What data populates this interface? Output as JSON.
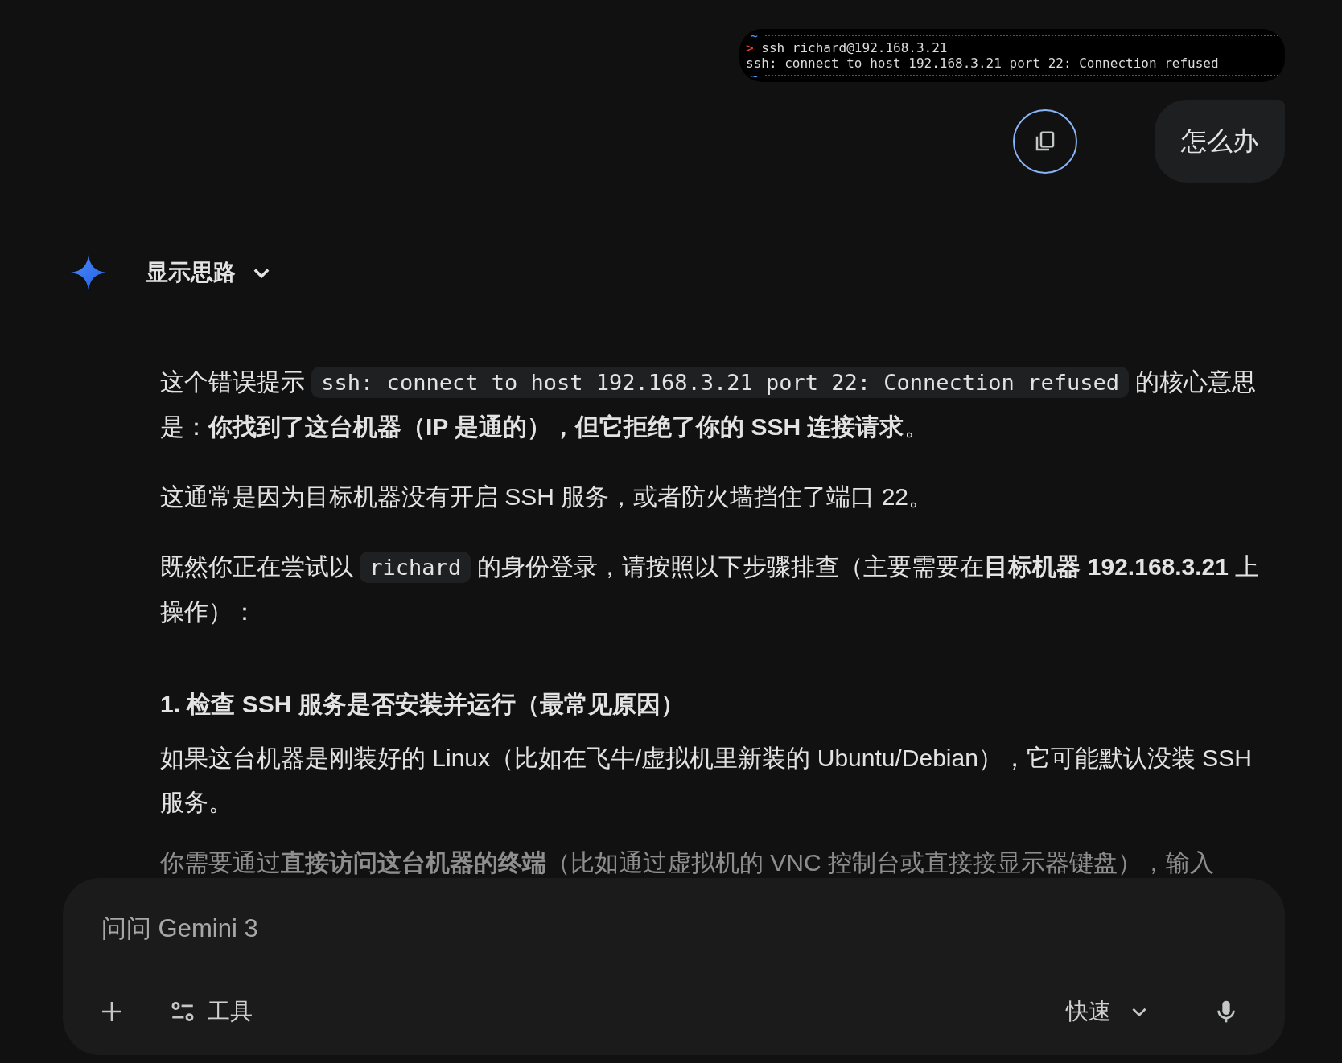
{
  "user_message": {
    "attachment": {
      "kind": "terminal",
      "lines": [
        {
          "kind": "tilde",
          "text": "~"
        },
        {
          "kind": "command",
          "prompt": ">",
          "text": "ssh richard@192.168.3.21"
        },
        {
          "kind": "output",
          "text": "ssh: connect to host 192.168.3.21 port 22: Connection refused"
        },
        {
          "kind": "tilde",
          "text": "~"
        }
      ]
    },
    "text": "怎么办"
  },
  "response": {
    "thoughts_toggle": {
      "label": "显示思路",
      "expanded": false
    },
    "blocks": [
      {
        "kind": "paragraph",
        "segments": [
          {
            "kind": "text",
            "text": "这个错误提示 "
          },
          {
            "kind": "code",
            "text": "ssh: connect to host 192.168.3.21 port 22: Connection refused"
          },
          {
            "kind": "text",
            "text": " 的核心意思是："
          },
          {
            "kind": "bold",
            "text": "你找到了这台机器（IP 是通的），但它拒绝了你的 SSH 连接请求"
          },
          {
            "kind": "text",
            "text": "。"
          }
        ]
      },
      {
        "kind": "paragraph",
        "segments": [
          {
            "kind": "text",
            "text": "这通常是因为目标机器没有开启 SSH 服务，或者防火墙挡住了端口 22。"
          }
        ]
      },
      {
        "kind": "paragraph",
        "segments": [
          {
            "kind": "text",
            "text": "既然你正在尝试以 "
          },
          {
            "kind": "code",
            "text": "richard"
          },
          {
            "kind": "text",
            "text": " 的身份登录，请按照以下步骤排查（主要需要在"
          },
          {
            "kind": "bold",
            "text": "目标机器 192.168.3.21"
          },
          {
            "kind": "text",
            "text": " 上操作）："
          }
        ]
      },
      {
        "kind": "heading",
        "segments": [
          {
            "kind": "text",
            "text": "1. 检查 SSH 服务是否安装并运行（最常见原因）"
          }
        ]
      },
      {
        "kind": "paragraph",
        "segments": [
          {
            "kind": "text",
            "text": "如果这台机器是刚装好的 Linux（比如在飞牛/虚拟机里新装的 Ubuntu/Debian），它可能默认没装 SSH 服务。"
          }
        ]
      },
      {
        "kind": "faded",
        "segments": [
          {
            "kind": "text",
            "text": "你需要通过"
          },
          {
            "kind": "bold",
            "text": "直接访问这台机器的终端"
          },
          {
            "kind": "text",
            "text": "（比如通过虚拟机的 VNC 控制台或直接接显示器键盘），输入"
          }
        ]
      }
    ]
  },
  "composer": {
    "placeholder": "问问 Gemini 3",
    "tools_label": "工具",
    "mode": "快速"
  }
}
